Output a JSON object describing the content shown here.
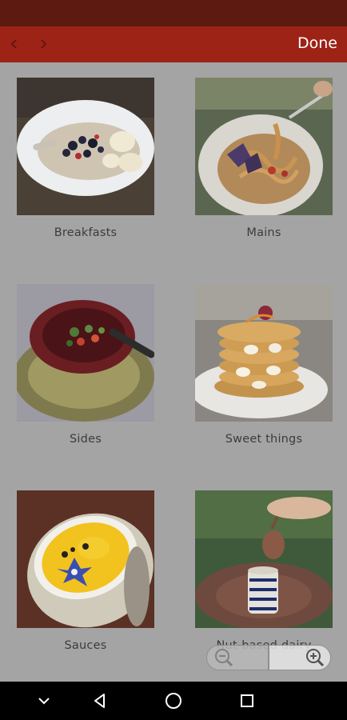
{
  "header": {
    "done_label": "Done"
  },
  "icons": {
    "back": "chevron-left-icon",
    "forward": "chevron-right-icon",
    "zoom_out": "zoom-out-icon",
    "zoom_in": "zoom-in-icon",
    "nav_down": "chevron-down-icon",
    "nav_back": "triangle-back-icon",
    "nav_home": "circle-home-icon",
    "nav_recent": "square-recent-icon"
  },
  "colors": {
    "status_bar": "#5c1a10",
    "top_bar": "#9d2316",
    "background": "#a4a4a4"
  },
  "categories": [
    {
      "label": "Breakfasts"
    },
    {
      "label": "Mains"
    },
    {
      "label": "Sides"
    },
    {
      "label": "Sweet things"
    },
    {
      "label": "Sauces"
    },
    {
      "label": "Nut-based dairy"
    }
  ]
}
